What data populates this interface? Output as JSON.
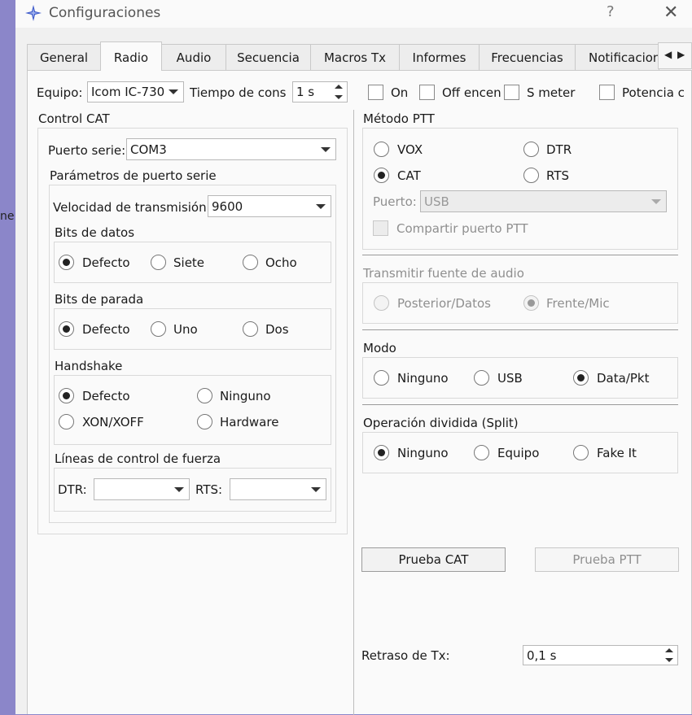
{
  "background_text": "ne",
  "window": {
    "title": "Configuraciones",
    "help_glyph": "?",
    "close_glyph": "✕"
  },
  "tabs": [
    {
      "label": "General",
      "active": false
    },
    {
      "label": "Radio",
      "active": true
    },
    {
      "label": "Audio",
      "active": false
    },
    {
      "label": "Secuencia",
      "active": false
    },
    {
      "label": "Macros Tx",
      "active": false
    },
    {
      "label": "Informes",
      "active": false
    },
    {
      "label": "Frecuencias",
      "active": false
    },
    {
      "label": "Notificacion",
      "active": false
    }
  ],
  "top_row": {
    "equipo_label": "Equipo:",
    "equipo_value": "Icom IC-730",
    "tiempo_label": "Tiempo de consu",
    "tiempo_value": "1 s",
    "chk_on": "On",
    "chk_off": "Off encen",
    "chk_smeter": "S meter",
    "chk_potencia": "Potencia c"
  },
  "cat": {
    "title": "Control CAT",
    "puerto_label": "Puerto serie:",
    "puerto_value": "COM3",
    "params_title": "Parámetros de puerto serie",
    "velocidad_label": "Velocidad de transmisión:",
    "velocidad_value": "9600",
    "bits_datos_title": "Bits de datos",
    "bits_datos": [
      "Defecto",
      "Siete",
      "Ocho"
    ],
    "bits_parada_title": "Bits de parada",
    "bits_parada": [
      "Defecto",
      "Uno",
      "Dos"
    ],
    "handshake_title": "Handshake",
    "handshake": [
      "Defecto",
      "Ninguno",
      "XON/XOFF",
      "Hardware"
    ],
    "lineas_title": "Líneas de control de fuerza",
    "dtr_label": "DTR:",
    "dtr_value": "",
    "rts_label": "RTS:",
    "rts_value": ""
  },
  "ptt": {
    "title": "Método PTT",
    "options": [
      "VOX",
      "DTR",
      "CAT",
      "RTS"
    ],
    "puerto_label": "Puerto:",
    "puerto_value": "USB",
    "compartir": "Compartir puerto PTT"
  },
  "audio_src": {
    "title": "Transmitir fuente de audio",
    "options": [
      "Posterior/Datos",
      "Frente/Mic"
    ]
  },
  "modo": {
    "title": "Modo",
    "options": [
      "Ninguno",
      "USB",
      "Data/Pkt"
    ]
  },
  "split": {
    "title": "Operación dividida (Split)",
    "options": [
      "Ninguno",
      "Equipo",
      "Fake It"
    ]
  },
  "buttons": {
    "prueba_cat": "Prueba CAT",
    "prueba_ptt": "Prueba PTT"
  },
  "retraso": {
    "label": "Retraso de Tx:",
    "value": "0,1 s"
  },
  "colors": {
    "desktop": "#8b86c9",
    "panel": "#fafafa",
    "icon_blue": "#3a57c9"
  }
}
